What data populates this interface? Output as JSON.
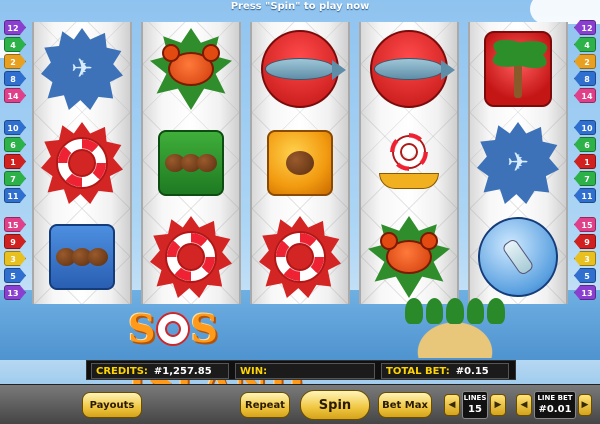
{
  "top_message": "Press \"Spin\" to play now",
  "paylines_left": [
    {
      "n": "12",
      "color": "#8a3fd0"
    },
    {
      "n": "4",
      "color": "#2db24a"
    },
    {
      "n": "2",
      "color": "#e8a020"
    },
    {
      "n": "8",
      "color": "#2f6fd0"
    },
    {
      "n": "14",
      "color": "#e0408a"
    },
    {
      "n": "10",
      "color": "#2f6fd0"
    },
    {
      "n": "6",
      "color": "#2db24a"
    },
    {
      "n": "1",
      "color": "#d02020"
    },
    {
      "n": "7",
      "color": "#2db24a"
    },
    {
      "n": "11",
      "color": "#2f6fd0"
    },
    {
      "n": "15",
      "color": "#e0408a"
    },
    {
      "n": "9",
      "color": "#d02020"
    },
    {
      "n": "3",
      "color": "#e8c020"
    },
    {
      "n": "5",
      "color": "#2f6fd0"
    },
    {
      "n": "13",
      "color": "#8a3fd0"
    }
  ],
  "paylines_right": [
    {
      "n": "12",
      "color": "#8a3fd0"
    },
    {
      "n": "4",
      "color": "#2db24a"
    },
    {
      "n": "2",
      "color": "#e8a020"
    },
    {
      "n": "8",
      "color": "#2f6fd0"
    },
    {
      "n": "14",
      "color": "#e0408a"
    },
    {
      "n": "10",
      "color": "#2f6fd0"
    },
    {
      "n": "6",
      "color": "#2db24a"
    },
    {
      "n": "1",
      "color": "#d02020"
    },
    {
      "n": "7",
      "color": "#2db24a"
    },
    {
      "n": "11",
      "color": "#2f6fd0"
    },
    {
      "n": "15",
      "color": "#e0408a"
    },
    {
      "n": "9",
      "color": "#d02020"
    },
    {
      "n": "3",
      "color": "#e8c020"
    },
    {
      "n": "5",
      "color": "#2f6fd0"
    },
    {
      "n": "13",
      "color": "#8a3fd0"
    }
  ],
  "reels": [
    [
      "plane-star",
      "lifebuoy",
      "coconuts-blue"
    ],
    [
      "crab",
      "coconuts-green",
      "lifebuoy"
    ],
    [
      "fish",
      "coconut-orange",
      "lifebuoy"
    ],
    [
      "fish",
      "sos-boat",
      "crab"
    ],
    [
      "palm-tree",
      "plane-star",
      "message-bottle"
    ]
  ],
  "logo": {
    "left": "S",
    "right": "S ISLAND"
  },
  "info": {
    "credits_label": "CREDITS:",
    "credits_value": "#1,257.85",
    "win_label": "WIN:",
    "win_value": "",
    "total_bet_label": "TOTAL BET:",
    "total_bet_value": "#0.15"
  },
  "controls": {
    "payouts": "Payouts",
    "repeat": "Repeat",
    "spin": "Spin",
    "bet_max": "Bet Max",
    "lines_label": "LINES",
    "lines_value": "15",
    "line_bet_label": "LINE BET",
    "line_bet_value": "#0.01",
    "prev_arrow": "◀",
    "next_arrow": "▶"
  },
  "colors": {
    "accent_yellow": "#ffd400",
    "button_gold": "#f0c640"
  }
}
